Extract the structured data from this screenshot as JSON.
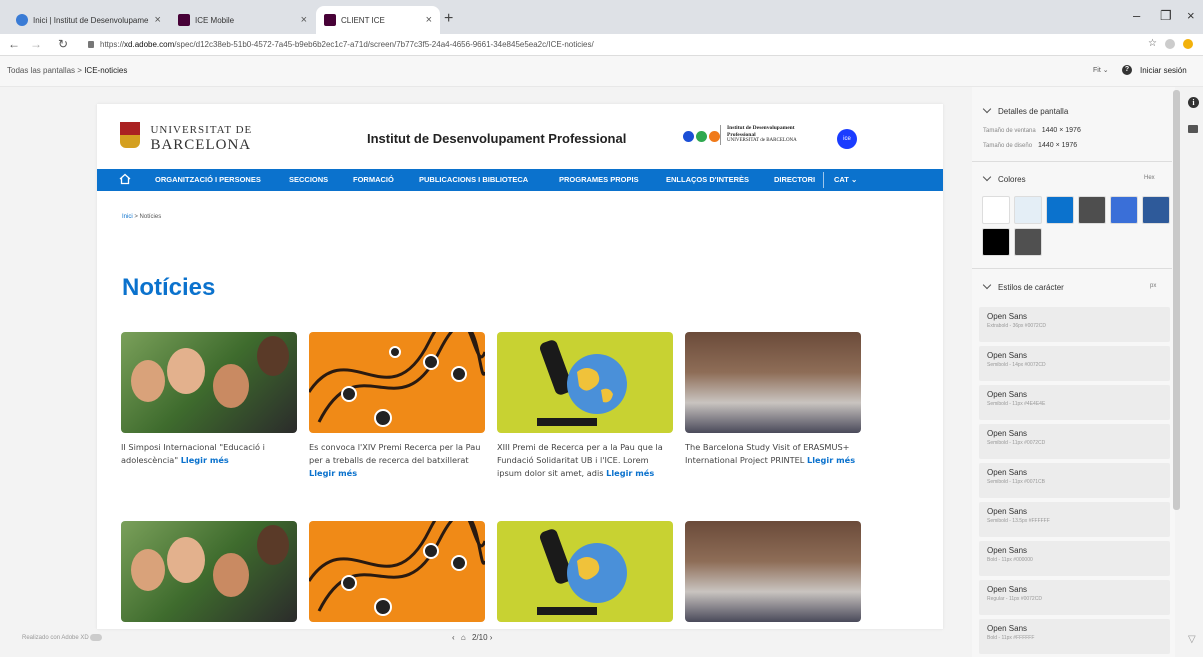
{
  "browser": {
    "tabs": [
      {
        "title": "Inici | Institut de Desenvolupame",
        "color": "#3a7bd5"
      },
      {
        "title": "ICE Mobile",
        "color": "#470137"
      },
      {
        "title": "CLIENT ICE",
        "color": "#470137"
      }
    ],
    "url_prefix": "https://",
    "url_domain": "xd.adobe.com",
    "url_path": "/spec/d12c38eb-51b0-4572-7a45-b9eb6b2ec1c7-a71d/screen/7b77c3f5-24a4-4656-9661-34e845e5ea2c/ICE-noticies/"
  },
  "xd": {
    "breadcrumb_root": "Todas las pantallas",
    "breadcrumb_sep": ">",
    "breadcrumb_current": "ICE-noticies",
    "fit_label": "Fit",
    "signin_label": "Iniciar sesión",
    "footer_made": "Realizado con Adobe XD",
    "pager": "2/10"
  },
  "site": {
    "logo_line1": "UNIVERSITAT DE",
    "logo_line2": "BARCELONA",
    "title": "Institut de Desenvolupament Professional",
    "inst_line1": "Institut de Desenvolupament",
    "inst_line2": "Professional",
    "inst_line3": "UNIVERSITAT de BARCELONA",
    "ice_badge": "ice",
    "nav": [
      "ORGANITZACIÓ I PERSONES",
      "SECCIONS",
      "FORMACIÓ",
      "PUBLICACIONS I BIBLIOTECA",
      "PROGRAMES PROPIS",
      "ENLLAÇOS D'INTERÈS",
      "DIRECTORI",
      "CAT"
    ],
    "breadcrumb_home": "Inici",
    "breadcrumb_sep": ">",
    "breadcrumb_current": "Notícies",
    "page_title": "Notícies",
    "read_more": "Llegir més",
    "news": [
      {
        "text": "II Simposi Internacional \"Educació i adolescència\""
      },
      {
        "text": "Es convoca l'XIV Premi Recerca per la Pau per a treballs de recerca del batxillerat"
      },
      {
        "text": "XIII Premi de Recerca per a la Pau que la Fundació Solidaritat UB i l'ICE. Lorem ipsum dolor sit amet, adis"
      },
      {
        "text": "The Barcelona Study Visit of ERASMUS+ International Project PRINTEL"
      }
    ]
  },
  "panel": {
    "screen_details": "Detalles de pantalla",
    "window_size_label": "Tamaño de ventana",
    "window_size": "1440 × 1976",
    "design_size_label": "Tamaño de diseño",
    "design_size": "1440 × 1976",
    "colors_label": "Colores",
    "colors_format": "Hex",
    "colors": [
      "#ffffff",
      "#e4eef6",
      "#0b72cd",
      "#4e4e4e",
      "#3a6fd8",
      "#2e5a9a",
      "#000000",
      "#505050"
    ],
    "char_styles_label": "Estilos de carácter",
    "char_styles_unit": "px",
    "char_styles": [
      {
        "name": "Open Sans",
        "desc": "Extrabold - 36px #0072CD"
      },
      {
        "name": "Open Sans",
        "desc": "Semibold - 14px #0072CD"
      },
      {
        "name": "Open Sans",
        "desc": "Semibold - 11px #4E4E4E"
      },
      {
        "name": "Open Sans",
        "desc": "Semibold - 11px #0072CD"
      },
      {
        "name": "Open Sans",
        "desc": "Semibold - 11px #0071CB"
      },
      {
        "name": "Open Sans",
        "desc": "Semibold - 13.5px #FFFFFF"
      },
      {
        "name": "Open Sans",
        "desc": "Bold - 11px #000000"
      },
      {
        "name": "Open Sans",
        "desc": "Regular - 11px #0072CD"
      },
      {
        "name": "Open Sans",
        "desc": "Bold - 11px #FFFFFF"
      }
    ]
  }
}
